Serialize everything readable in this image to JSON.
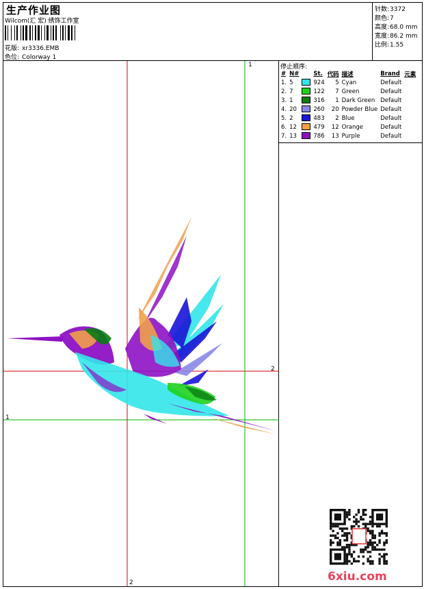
{
  "header": {
    "title": "生产作业图",
    "studio": "Wilcom(汇 宏) 绣饰工作室",
    "design_label": "花版:",
    "design_value": "xr3336.EMB",
    "colorway_label": "色位:",
    "colorway_value": "Colorway 1"
  },
  "stats": {
    "stitches_label": "针数:",
    "stitches_value": "3372",
    "colors_label": "颜色:",
    "colors_value": "7",
    "height_label": "高度:",
    "height_value": "68.0 mm",
    "width_label": "宽度:",
    "width_value": "86.2 mm",
    "scale_label": "比例:",
    "scale_value": "1.55"
  },
  "thread_panel": {
    "stop_sequence_label": "停止顺序:",
    "columns": [
      "#",
      "N#",
      "St.",
      "代码",
      "描述",
      "Brand",
      "元素"
    ],
    "rows": [
      {
        "idx": "1.",
        "n": "5",
        "color": "#33e5ea",
        "st": "924",
        "code": "5",
        "desc": "Cyan",
        "brand": "Default"
      },
      {
        "idx": "2.",
        "n": "7",
        "color": "#1fd11f",
        "st": "122",
        "code": "7",
        "desc": "Green",
        "brand": "Default"
      },
      {
        "idx": "3.",
        "n": "1",
        "color": "#0a7d13",
        "st": "316",
        "code": "1",
        "desc": "Dark Green",
        "brand": "Default"
      },
      {
        "idx": "4.",
        "n": "20",
        "color": "#8a86e8",
        "st": "260",
        "code": "20",
        "desc": "Powder Blue",
        "brand": "Default"
      },
      {
        "idx": "5.",
        "n": "2",
        "color": "#1a14d6",
        "st": "483",
        "code": "2",
        "desc": "Blue",
        "brand": "Default"
      },
      {
        "idx": "6.",
        "n": "12",
        "color": "#f0a04a",
        "st": "479",
        "code": "12",
        "desc": "Orange",
        "brand": "Default"
      },
      {
        "idx": "7.",
        "n": "13",
        "color": "#8e12c4",
        "st": "786",
        "code": "13",
        "desc": "Purple",
        "brand": "Default"
      }
    ]
  },
  "guides": {
    "v1": "1",
    "h2": "2",
    "h1": "1",
    "v2": "2"
  },
  "watermark": "6xiu.com",
  "colors": {
    "red_guide": "#e00000",
    "green_guide": "#00b000"
  }
}
